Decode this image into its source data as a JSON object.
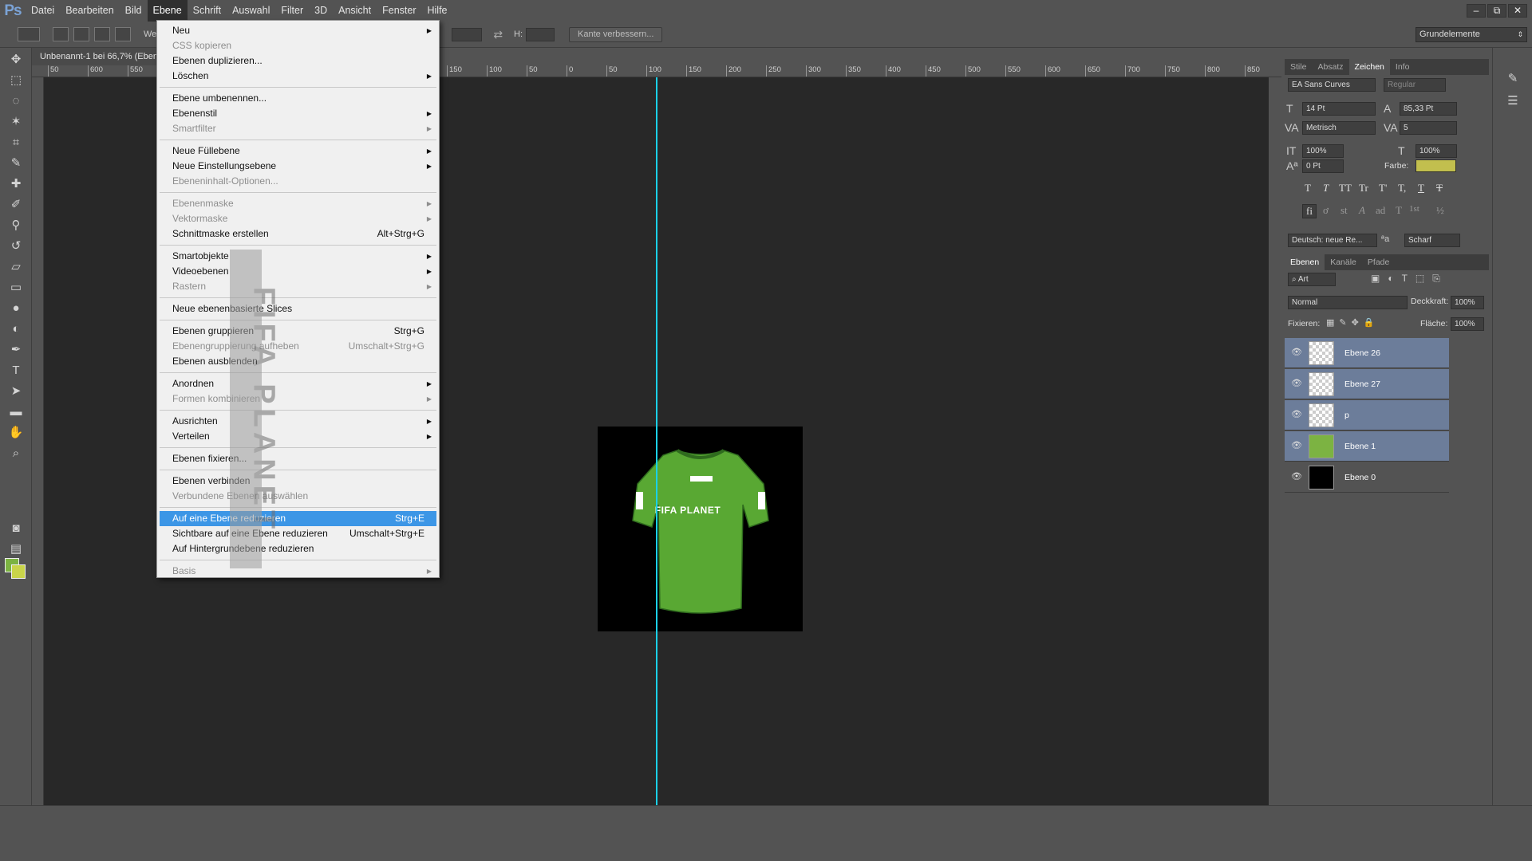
{
  "app": {
    "logo": "Ps"
  },
  "menubar": {
    "items": [
      "Datei",
      "Bearbeiten",
      "Bild",
      "Ebene",
      "Schrift",
      "Auswahl",
      "Filter",
      "3D",
      "Ansicht",
      "Fenster",
      "Hilfe"
    ],
    "active": "Ebene"
  },
  "window_controls": [
    "–",
    "⧉",
    "✕"
  ],
  "options_bar": {
    "w_label": "We",
    "h_label": "H:",
    "refine_edge": "Kante verbessern...",
    "workspace": "Grundelemente"
  },
  "document": {
    "tab_title": "Unbenannt-1 bei 66,7% (Ebene"
  },
  "ruler": {
    "top_ticks": [
      "50",
      "600",
      "550",
      "500",
      "450",
      "400",
      "350",
      "300",
      "250",
      "200",
      "150",
      "100",
      "50",
      "0",
      "50",
      "100",
      "150",
      "200",
      "250",
      "300",
      "350",
      "400",
      "450",
      "500",
      "550",
      "600",
      "650",
      "700",
      "750",
      "800",
      "850"
    ]
  },
  "canvas": {
    "jersey_label": "FIFA PLANET"
  },
  "ebene_menu": {
    "items": [
      {
        "label": "Neu",
        "submenu": true
      },
      {
        "label": "CSS kopieren",
        "disabled": true
      },
      {
        "label": "Ebenen duplizieren..."
      },
      {
        "label": "Löschen",
        "submenu": true
      },
      {
        "sep": true
      },
      {
        "label": "Ebene umbenennen..."
      },
      {
        "label": "Ebenenstil",
        "submenu": true
      },
      {
        "label": "Smartfilter",
        "disabled": true,
        "submenu": true
      },
      {
        "sep": true
      },
      {
        "label": "Neue Füllebene",
        "submenu": true
      },
      {
        "label": "Neue Einstellungsebene",
        "submenu": true
      },
      {
        "label": "Ebeneninhalt-Optionen...",
        "disabled": true
      },
      {
        "sep": true
      },
      {
        "label": "Ebenenmaske",
        "disabled": true,
        "submenu": true
      },
      {
        "label": "Vektormaske",
        "disabled": true,
        "submenu": true
      },
      {
        "label": "Schnittmaske erstellen",
        "shortcut": "Alt+Strg+G"
      },
      {
        "sep": true
      },
      {
        "label": "Smartobjekte",
        "submenu": true
      },
      {
        "label": "Videoebenen",
        "submenu": true
      },
      {
        "label": "Rastern",
        "disabled": true,
        "submenu": true
      },
      {
        "sep": true
      },
      {
        "label": "Neue ebenenbasierte Slices"
      },
      {
        "sep": true
      },
      {
        "label": "Ebenen gruppieren",
        "shortcut": "Strg+G"
      },
      {
        "label": "Ebenengruppierung aufheben",
        "shortcut": "Umschalt+Strg+G",
        "disabled": true
      },
      {
        "label": "Ebenen ausblenden"
      },
      {
        "sep": true
      },
      {
        "label": "Anordnen",
        "submenu": true
      },
      {
        "label": "Formen kombinieren",
        "disabled": true,
        "submenu": true
      },
      {
        "sep": true
      },
      {
        "label": "Ausrichten",
        "submenu": true
      },
      {
        "label": "Verteilen",
        "submenu": true
      },
      {
        "sep": true
      },
      {
        "label": "Ebenen fixieren..."
      },
      {
        "sep": true
      },
      {
        "label": "Ebenen verbinden"
      },
      {
        "label": "Verbundene Ebenen auswählen",
        "disabled": true
      },
      {
        "sep": true
      },
      {
        "label": "Auf eine Ebene reduzieren",
        "shortcut": "Strg+E",
        "highlight": true
      },
      {
        "label": "Sichtbare auf eine Ebene reduzieren",
        "shortcut": "Umschalt+Strg+E"
      },
      {
        "label": "Auf Hintergrundebene reduzieren"
      },
      {
        "sep": true
      },
      {
        "label": "Basis",
        "disabled": true,
        "submenu": true
      }
    ]
  },
  "watermark": {
    "text": "FIFA PLANET"
  },
  "char_panel": {
    "tabs": [
      "Stile",
      "Absatz",
      "Zeichen",
      "Info"
    ],
    "active_tab": "Zeichen",
    "font_family": "EA Sans Curves",
    "font_style": "Regular",
    "font_size": "14 Pt",
    "leading": "85,33 Pt",
    "kerning": "Metrisch",
    "tracking": "5",
    "vertical_scale": "100%",
    "horizontal_scale": "100%",
    "baseline_shift": "0 Pt",
    "color_label": "Farbe:",
    "language": "Deutsch: neue Re...",
    "antialias": "Scharf",
    "type_buttons": [
      "T",
      "T",
      "TT",
      "Tr",
      "T'",
      "T,",
      "T",
      "T"
    ],
    "ot_buttons": [
      "fi",
      "ơ",
      "st",
      "A",
      "ad",
      "T",
      "1st",
      "½"
    ]
  },
  "layers_panel": {
    "tabs": [
      "Ebenen",
      "Kanäle",
      "Pfade"
    ],
    "active_tab": "Ebenen",
    "filter": "Art",
    "blend_mode": "Normal",
    "opacity_label": "Deckkraft:",
    "opacity": "100%",
    "lock_label": "Fixieren:",
    "fill_label": "Fläche:",
    "fill": "100%",
    "layers": [
      {
        "name": "Ebene 26",
        "thumb": "transparent",
        "selected": true
      },
      {
        "name": "Ebene 27",
        "thumb": "transparent",
        "selected": true
      },
      {
        "name": "p",
        "thumb": "transparent",
        "selected": true
      },
      {
        "name": "Ebene 1",
        "thumb": "green",
        "selected": true
      },
      {
        "name": "Ebene 0",
        "thumb": "black",
        "selected": false
      }
    ]
  },
  "colors": {
    "guide": "#1ad1e8",
    "menu_highlight": "#3c96e6",
    "layer_selected": "#6c7d9a",
    "foreground": "#7cb342",
    "background": "#c9d44a",
    "text_color_swatch": "#c2bf4e"
  }
}
